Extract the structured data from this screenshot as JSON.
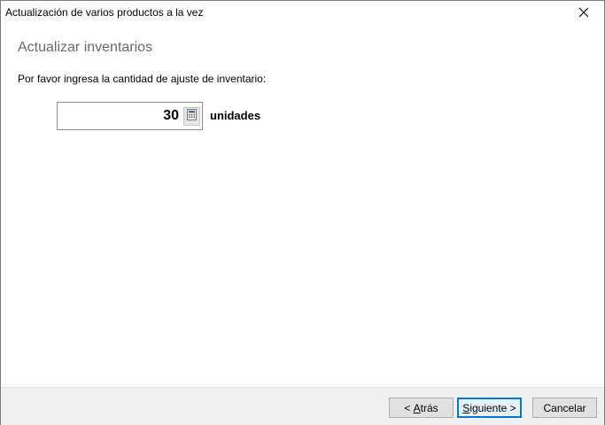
{
  "window": {
    "title": "Actualización de varios productos a la vez"
  },
  "page": {
    "heading": "Actualizar inventarios",
    "prompt": "Por favor ingresa la cantidad de ajuste de inventario:"
  },
  "quantity": {
    "value": "30",
    "unit": "unidades"
  },
  "buttons": {
    "back_prefix": "< ",
    "back_mnemonic": "A",
    "back_rest": "trás",
    "next_mnemonic": "S",
    "next_rest": "iguiente >",
    "cancel": "Cancelar"
  },
  "colors": {
    "heading": "#6a6a6a",
    "footer_bg": "#f0f0f0",
    "default_button_border": "#0078d7"
  }
}
